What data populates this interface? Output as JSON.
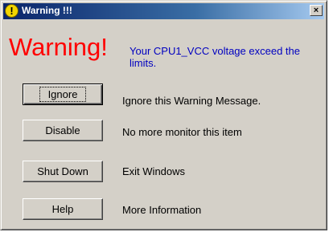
{
  "window": {
    "title": "Warning !!!",
    "title_icon": "!",
    "close_glyph": "×"
  },
  "warning": {
    "heading": "Warning!",
    "message": "Your CPU1_VCC voltage exceed the limits."
  },
  "actions": [
    {
      "button": "Ignore",
      "description": "Ignore this Warning Message."
    },
    {
      "button": "Disable",
      "description": "No more monitor this item"
    },
    {
      "button": "Shut Down",
      "description": "Exit Windows"
    },
    {
      "button": "Help",
      "description": "More Information"
    }
  ],
  "colors": {
    "title_bar": "#0a246a",
    "warning_heading": "#ff0000",
    "warning_message": "#0000c0",
    "face": "#d4d0c8"
  }
}
